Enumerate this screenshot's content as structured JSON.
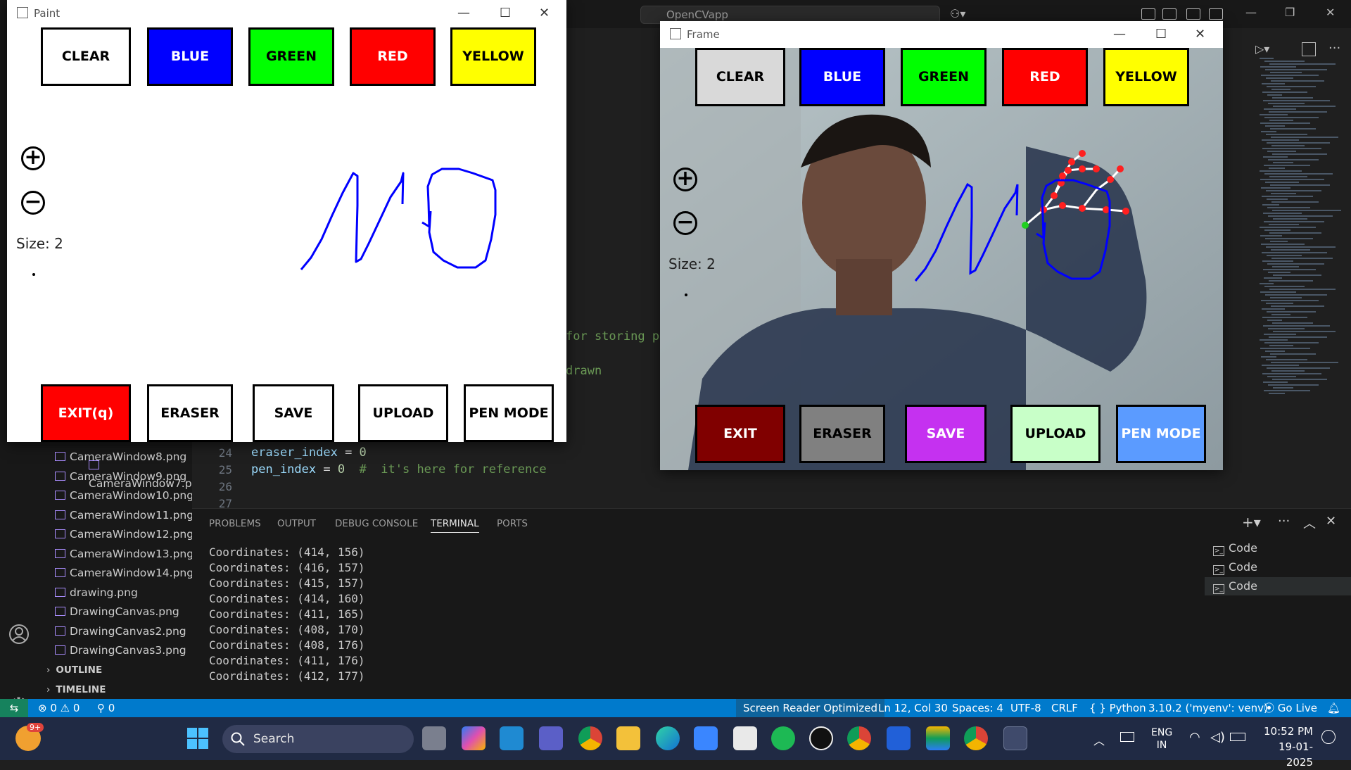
{
  "vscode": {
    "command_center": "OpenCVapp",
    "files": [
      "CameraWindow8.png",
      "CameraWindow9.png",
      "CameraWindow10.png",
      "CameraWindow11.png",
      "CameraWindow12.png",
      "CameraWindow13.png",
      "CameraWindow14.png",
      "drawing.png",
      "DrawingCanvas.png",
      "DrawingCanvas2.png",
      "DrawingCanvas3.png"
    ],
    "sections": {
      "outline": "OUTLINE",
      "timeline": "TIMELINE"
    },
    "code": [
      {
        "line": "24",
        "var": "eraser_index",
        "op": " = ",
        "num": "0",
        "comment": ""
      },
      {
        "line": "25",
        "var": "pen_index",
        "op": " = ",
        "num": "0",
        "comment": "  #  it's here for reference"
      },
      {
        "line": "26",
        "var": "",
        "op": "",
        "num": "",
        "comment": ""
      },
      {
        "line": "27",
        "var": "",
        "op": "",
        "num": "",
        "comment": ""
      }
    ],
    "bg_fragments": [
      "for storing pe",
      "drawn"
    ],
    "panel_tabs": [
      "PROBLEMS",
      "OUTPUT",
      "DEBUG CONSOLE",
      "TERMINAL",
      "PORTS"
    ],
    "terminal_lines": [
      "Coordinates: (414, 156)",
      "Coordinates: (416, 157)",
      "Coordinates: (415, 157)",
      "Coordinates: (414, 160)",
      "Coordinates: (411, 165)",
      "Coordinates: (408, 170)",
      "Coordinates: (408, 176)",
      "Coordinates: (411, 176)",
      "Coordinates: (412, 177)"
    ],
    "terminals": [
      "Code",
      "Code",
      "Code"
    ],
    "status": {
      "errors": "0",
      "warnings": "0",
      "ports": "0",
      "screen_reader": "Screen Reader Optimized",
      "position": "Ln 12, Col 30",
      "spaces": "Spaces: 4",
      "encoding": "UTF-8",
      "eol": "CRLF",
      "language": "Python",
      "interpreter": "3.10.2 ('myenv': venv)",
      "golive": "Go Live"
    }
  },
  "paint": {
    "title": "Paint",
    "top_buttons": [
      {
        "label": "CLEAR",
        "bg": "#ffffff",
        "fg": "#000000"
      },
      {
        "label": "BLUE",
        "bg": "#0000ff",
        "fg": "#ffffff"
      },
      {
        "label": "GREEN",
        "bg": "#00ff00",
        "fg": "#000000"
      },
      {
        "label": "RED",
        "bg": "#ff0000",
        "fg": "#ffffff"
      },
      {
        "label": "YELLOW",
        "bg": "#ffff00",
        "fg": "#000000"
      }
    ],
    "bottom_buttons": [
      {
        "label": "EXIT(q)",
        "bg": "#ff0000",
        "fg": "#ffffff"
      },
      {
        "label": "ERASER",
        "bg": "#ffffff",
        "fg": "#000000"
      },
      {
        "label": "SAVE",
        "bg": "#ffffff",
        "fg": "#000000"
      },
      {
        "label": "UPLOAD",
        "bg": "#ffffff",
        "fg": "#000000"
      },
      {
        "label": "PEN MODE",
        "bg": "#ffffff",
        "fg": "#000000"
      }
    ],
    "zoom_in": "+",
    "zoom_out": "−",
    "size_label": "Size: 2"
  },
  "frame": {
    "title": "Frame",
    "top_buttons": [
      {
        "label": "CLEAR",
        "bg": "#d9d9d9",
        "fg": "#000000"
      },
      {
        "label": "BLUE",
        "bg": "#0000ff",
        "fg": "#ffffff"
      },
      {
        "label": "GREEN",
        "bg": "#00ff00",
        "fg": "#000000"
      },
      {
        "label": "RED",
        "bg": "#ff0000",
        "fg": "#ffffff"
      },
      {
        "label": "YELLOW",
        "bg": "#ffff00",
        "fg": "#000000"
      }
    ],
    "bottom_buttons": [
      {
        "label": "EXIT",
        "bg": "#800000",
        "fg": "#ffffff"
      },
      {
        "label": "ERASER",
        "bg": "#808080",
        "fg": "#000000"
      },
      {
        "label": "SAVE",
        "bg": "#c531f0",
        "fg": "#ffffff"
      },
      {
        "label": "UPLOAD",
        "bg": "#c8ffc8",
        "fg": "#000000"
      },
      {
        "label": "PEN MODE",
        "bg": "#5b9bff",
        "fg": "#ffffff"
      }
    ],
    "zoom_in": "+",
    "zoom_out": "−",
    "size_label": "Size: 2"
  },
  "taskbar": {
    "search": "Search",
    "badge": "9+",
    "lang": "ENG",
    "region": "IN",
    "time": "10:52 PM",
    "date": "19-01-2025"
  },
  "colors": {
    "accent": "#007acc",
    "stroke": "#0000ff"
  }
}
